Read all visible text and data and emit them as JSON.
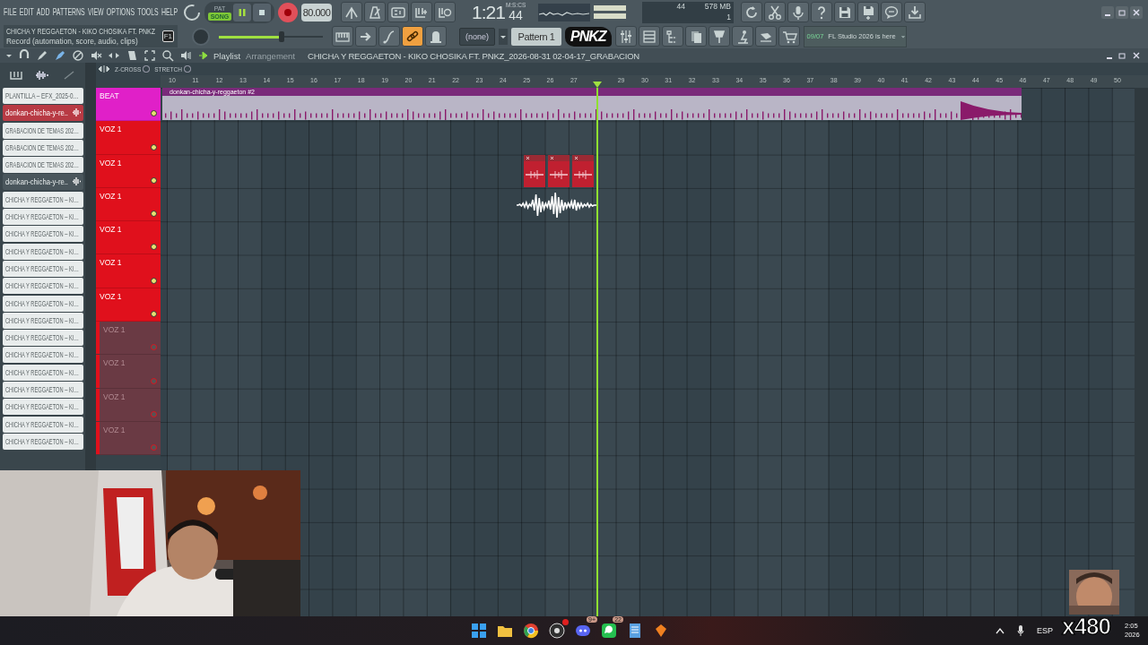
{
  "menu": [
    "FILE",
    "EDIT",
    "ADD",
    "PATTERNS",
    "VIEW",
    "OPTIONS",
    "TOOLS",
    "HELP"
  ],
  "transport": {
    "pat_label": "PAT",
    "song_label": "SONG",
    "song_mode": true,
    "playing": true,
    "recording": true
  },
  "tempo": "80.000",
  "time": {
    "value": "1:21",
    "sub": "44",
    "unit": "M:S:CS"
  },
  "cpu": {
    "value": "44",
    "memory": "578 MB",
    "polyphony": "1"
  },
  "hint": {
    "title": "CHICHA Y REGGAETON - KIKO CHOSIKA FT. PNKZ",
    "text": "Record (automation, score, audio, clips)",
    "key": "F1"
  },
  "master_volume": {
    "level": 0.6
  },
  "snap": "(none)",
  "pattern": "Pattern 1",
  "sticker": "PNKZ",
  "news": {
    "date": "09/07",
    "text": "FL Studio 2026 is here"
  },
  "browser": {
    "items": [
      {
        "label": "PLANTILLA – EFX_2025-0…",
        "selected": false,
        "focused": false
      },
      {
        "label": "donkan-chicha-y-re..",
        "selected": true,
        "focused": false
      },
      {
        "label": "GRABACION DE TEMAS 202…",
        "selected": false,
        "focused": false
      },
      {
        "label": "GRABACION DE TEMAS 202…",
        "selected": false,
        "focused": false
      },
      {
        "label": "GRABACION DE TEMAS 202…",
        "selected": false,
        "focused": false
      },
      {
        "label": "donkan-chicha-y-re..",
        "selected": false,
        "focused": true
      },
      {
        "label": "CHICHA Y REGGAETON – KI…",
        "selected": false,
        "focused": false
      },
      {
        "label": "CHICHA Y REGGAETON – KI…",
        "selected": false,
        "focused": false
      },
      {
        "label": "CHICHA Y REGGAETON – KI…",
        "selected": false,
        "focused": false
      },
      {
        "label": "CHICHA Y REGGAETON – KI…",
        "selected": false,
        "focused": false
      },
      {
        "label": "CHICHA Y REGGAETON – KI…",
        "selected": false,
        "focused": false
      },
      {
        "label": "CHICHA Y REGGAETON – KI…",
        "selected": false,
        "focused": false
      },
      {
        "label": "CHICHA Y REGGAETON – KI…",
        "selected": false,
        "focused": false
      },
      {
        "label": "CHICHA Y REGGAETON – KI…",
        "selected": false,
        "focused": false
      },
      {
        "label": "CHICHA Y REGGAETON – KI…",
        "selected": false,
        "focused": false
      },
      {
        "label": "CHICHA Y REGGAETON – KI…",
        "selected": false,
        "focused": false
      },
      {
        "label": "CHICHA Y REGGAETON – KI…",
        "selected": false,
        "focused": false
      },
      {
        "label": "CHICHA Y REGGAETON – KI…",
        "selected": false,
        "focused": false
      },
      {
        "label": "CHICHA Y REGGAETON – KI…",
        "selected": false,
        "focused": false
      },
      {
        "label": "CHICHA Y REGGAETON – KI…",
        "selected": false,
        "focused": false
      },
      {
        "label": "CHICHA Y REGGAETON – KI…",
        "selected": false,
        "focused": false
      }
    ]
  },
  "playlist": {
    "title": "Playlist",
    "subtitle": "Arrangement",
    "project": "CHICHA Y REGGAETON - KIKO CHOSIKA FT. PNKZ_2026-08-31 02-04-17_GRABACION",
    "toggles": [
      {
        "label": "Z-CROSS",
        "on": false
      },
      {
        "label": "STRETCH",
        "on": false
      }
    ],
    "ruler": [
      "10",
      "11",
      "12",
      "13",
      "14",
      "15",
      "16",
      "17",
      "18",
      "19",
      "20",
      "21",
      "22",
      "23",
      "24",
      "25",
      "26",
      "27"
    ],
    "ruler_after_playhead": [
      "29",
      "30",
      "31",
      "32",
      "33",
      "34",
      "35",
      "36",
      "37",
      "38",
      "39",
      "40",
      "41",
      "42",
      "43",
      "44",
      "45",
      "46",
      "47",
      "48",
      "49",
      "50"
    ],
    "clip_label": "donkan-chicha-y-reggaeton #2",
    "tracks": [
      {
        "name": "BEAT",
        "color": "#e020c8",
        "enabled": true
      },
      {
        "name": "VOZ 1",
        "color": "#e0101c",
        "enabled": true
      },
      {
        "name": "VOZ 1",
        "color": "#e0101c",
        "enabled": true
      },
      {
        "name": "VOZ 1",
        "color": "#e0101c",
        "enabled": true
      },
      {
        "name": "VOZ 1",
        "color": "#e0101c",
        "enabled": true
      },
      {
        "name": "VOZ 1",
        "color": "#e0101c",
        "enabled": true
      },
      {
        "name": "VOZ 1",
        "color": "#e0101c",
        "enabled": true
      },
      {
        "name": "VOZ 1",
        "color": "#e0101c",
        "enabled": false
      },
      {
        "name": "VOZ 1",
        "color": "#e0101c",
        "enabled": false
      },
      {
        "name": "VOZ 1",
        "color": "#e0101c",
        "enabled": false
      },
      {
        "name": "VOZ 1",
        "color": "#e0101c",
        "enabled": false
      }
    ]
  },
  "taskbar": {
    "apps": [
      {
        "alert": false
      },
      {
        "alert": false
      },
      {
        "alert": false
      },
      {
        "alert": true
      },
      {
        "alert": false,
        "badge": "9+"
      },
      {
        "alert": false,
        "badge": "22"
      },
      {
        "alert": false
      },
      {
        "alert": false
      }
    ],
    "language": "ESP",
    "clock": {
      "time": "2:05",
      "date": "2026"
    }
  },
  "overlay": {
    "text": "x480"
  }
}
